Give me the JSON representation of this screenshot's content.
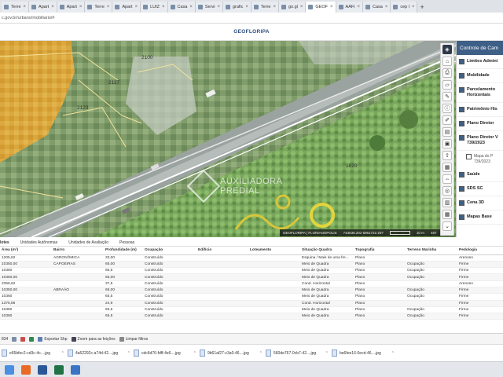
{
  "browser": {
    "tabs": [
      {
        "label": "Terre",
        "active": false
      },
      {
        "label": "Apart",
        "active": false
      },
      {
        "label": "Apart",
        "active": false
      },
      {
        "label": "Terre",
        "active": false
      },
      {
        "label": "Apart",
        "active": false
      },
      {
        "label": "LUIZ",
        "active": false
      },
      {
        "label": "Casa",
        "active": false
      },
      {
        "label": "Servi",
        "active": false
      },
      {
        "label": "grafic",
        "active": false
      },
      {
        "label": "Terre",
        "active": false
      },
      {
        "label": "go.gl",
        "active": false
      },
      {
        "label": "GEOF",
        "active": true
      },
      {
        "label": "AAFi",
        "active": false
      },
      {
        "label": "Casa",
        "active": false
      },
      {
        "label": "cep l",
        "active": false
      }
    ],
    "close_glyph": "×",
    "new_tab_glyph": "+",
    "url": "c.gov.br/urbano/mobiliario/#"
  },
  "app": {
    "title": "GEOFLORIPA"
  },
  "map": {
    "lot_labels": [
      "2100",
      "2117",
      "2129",
      "1820"
    ],
    "watermark": {
      "line1": "AUXILIADORA",
      "line2": "PREDIAL"
    },
    "status": {
      "source": "GEOFLORIPA | FLORIANOPOLIS",
      "coords": "744638.202 6961722.207",
      "scale": "10 m",
      "zoom": "467"
    },
    "tools": [
      {
        "icon": "layers-icon",
        "glyph": "◈"
      },
      {
        "icon": "home-icon",
        "glyph": "⌂"
      },
      {
        "icon": "print-icon",
        "glyph": "⎙"
      },
      {
        "icon": "ruler-icon",
        "glyph": "▱"
      },
      {
        "icon": "pencil-icon",
        "glyph": "✎"
      },
      {
        "icon": "info-icon",
        "glyph": "ⓘ"
      },
      {
        "icon": "edit-icon",
        "glyph": "✐"
      },
      {
        "icon": "document-icon",
        "glyph": "▤"
      },
      {
        "icon": "save-icon",
        "glyph": "▣"
      },
      {
        "icon": "share-icon",
        "glyph": "⇪"
      },
      {
        "icon": "chart-icon",
        "glyph": "▦"
      },
      {
        "icon": "arrows-icon",
        "glyph": "⇔"
      },
      {
        "icon": "globe-icon",
        "glyph": "◎"
      },
      {
        "icon": "table-icon",
        "glyph": "▥"
      },
      {
        "icon": "grid-icon",
        "glyph": "▦"
      },
      {
        "icon": "chevron-down-icon",
        "glyph": "⌄"
      }
    ]
  },
  "layers_panel": {
    "title": "Controle de Cam",
    "items": [
      {
        "label": "Limites Admini"
      },
      {
        "label": "Mobilidade"
      },
      {
        "label": "Parcelamento Horizontais"
      },
      {
        "label": "Patrimônio His"
      },
      {
        "label": "Plano Diretor"
      },
      {
        "label": "Plano Diretor V 739/2023"
      }
    ],
    "subitem": {
      "label": "Mapa do P 739/2023"
    },
    "items_after": [
      {
        "label": "Saúde"
      },
      {
        "label": "SDS SC"
      },
      {
        "label": "Cena 3D"
      },
      {
        "label": "Mapas Base"
      }
    ]
  },
  "results": {
    "tabs": [
      "lotes",
      "Unidades Autônomas",
      "Unidades de Avaliação",
      "Pessoas"
    ],
    "columns": [
      "Área (m²)",
      "Bairro",
      "Profundidade (m)",
      "Ocupação",
      "Edifício",
      "Loteamento",
      "Situação Quadra",
      "Topografia",
      "Terreno Marinha",
      "Pedologia"
    ],
    "rows": [
      [
        "1205,62",
        "AGRONÔMICA",
        "33,00",
        "Construído",
        "",
        "",
        "Esquina / Mais de uma fre...",
        "Plano",
        "",
        "Arenoso"
      ],
      [
        "10350,00",
        "CAPOEIRAS",
        "65,00",
        "Construído",
        "",
        "",
        "Meio de Quadra",
        "Plano",
        "Ocupação",
        "Firme"
      ],
      [
        "10360",
        "",
        "65,5",
        "Construído",
        "",
        "",
        "Meio de Quadra",
        "Plano",
        "Ocupação",
        "Firme"
      ],
      [
        "10350,00",
        "",
        "65,00",
        "Construído",
        "",
        "",
        "Meio de Quadra",
        "Plano",
        "Ocupação",
        "Firme"
      ],
      [
        "2356,62",
        "",
        "37,5",
        "Construído",
        "",
        "",
        "Cond. Horizontal",
        "Plano",
        "",
        "Arenoso"
      ],
      [
        "10350,00",
        "ABRAÃO",
        "65,00",
        "Construído",
        "",
        "",
        "Meio de Quadra",
        "Plano",
        "Ocupação",
        "Firme"
      ],
      [
        "10360",
        "",
        "65,5",
        "Construído",
        "",
        "",
        "Meio de Quadra",
        "Plano",
        "Ocupação",
        "Firme"
      ],
      [
        "1375,86",
        "",
        "24,9",
        "Construído",
        "",
        "",
        "Cond. Horizontal",
        "Plano",
        "",
        "Firme"
      ],
      [
        "10360",
        "",
        "65,5",
        "Construído",
        "",
        "",
        "Meio de Quadra",
        "Plano",
        "Ocupação",
        "Firme"
      ],
      [
        "10360",
        "",
        "65,5",
        "Construído",
        "",
        "",
        "Meio de Quadra",
        "Plano",
        "Ocupação",
        "Firme"
      ]
    ]
  },
  "bottom_toolbar": {
    "count": "834",
    "export": "Exportar Shp",
    "zoom": "Zoom para as feições",
    "clear": "Limpar filtros"
  },
  "downloads": [
    {
      "name": "e65bfec2-cd3c-4c....jpg"
    },
    {
      "name": "4a52292c-a74d-42....jpg"
    },
    {
      "name": "cdc6d76-fdff-4e6....jpg"
    },
    {
      "name": "9b61af27-c3a0-46....jpg"
    },
    {
      "name": "560de767-0cb7-42....jpg"
    },
    {
      "name": "be6fee16-0ecd-46....jpg"
    }
  ],
  "download_chevron": "⌃",
  "taskbar": [
    {
      "icon": "chrome-icon",
      "color": "#4a8fe0"
    },
    {
      "icon": "firefox-icon",
      "color": "#e96a25"
    },
    {
      "icon": "word-icon",
      "color": "#2b5797"
    },
    {
      "icon": "excel-icon",
      "color": "#217346"
    },
    {
      "icon": "photos-icon",
      "color": "#3a74c4"
    }
  ]
}
